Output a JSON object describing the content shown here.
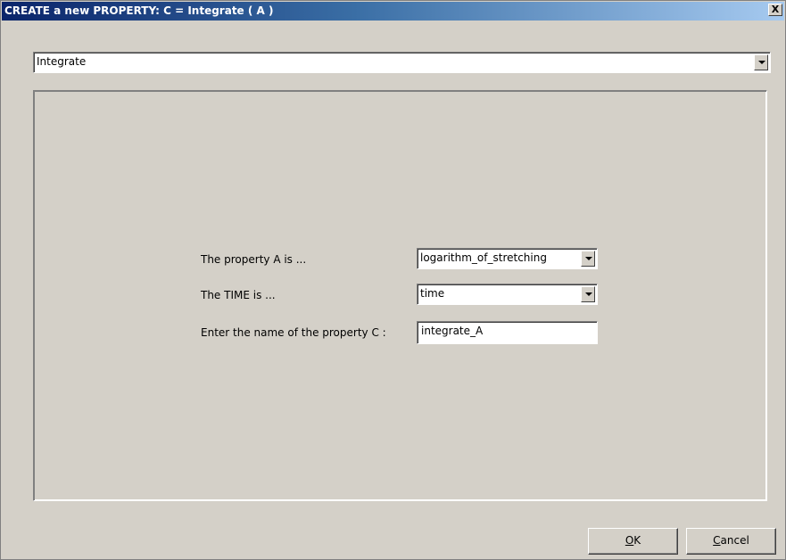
{
  "window": {
    "title": "CREATE a new PROPERTY: C = Integrate ( A )",
    "close_glyph": "X"
  },
  "operation_select": {
    "value": "Integrate"
  },
  "form": {
    "property_a_label": "The property A is ...",
    "property_a_value": "logarithm_of_stretching",
    "time_label": "The TIME is ...",
    "time_value": "time",
    "name_c_label": "Enter the name of the property C :",
    "name_c_value": "integrate_A"
  },
  "buttons": {
    "ok_mnemonic": "O",
    "ok_rest": "K",
    "cancel_mnemonic": "C",
    "cancel_rest": "ancel"
  }
}
